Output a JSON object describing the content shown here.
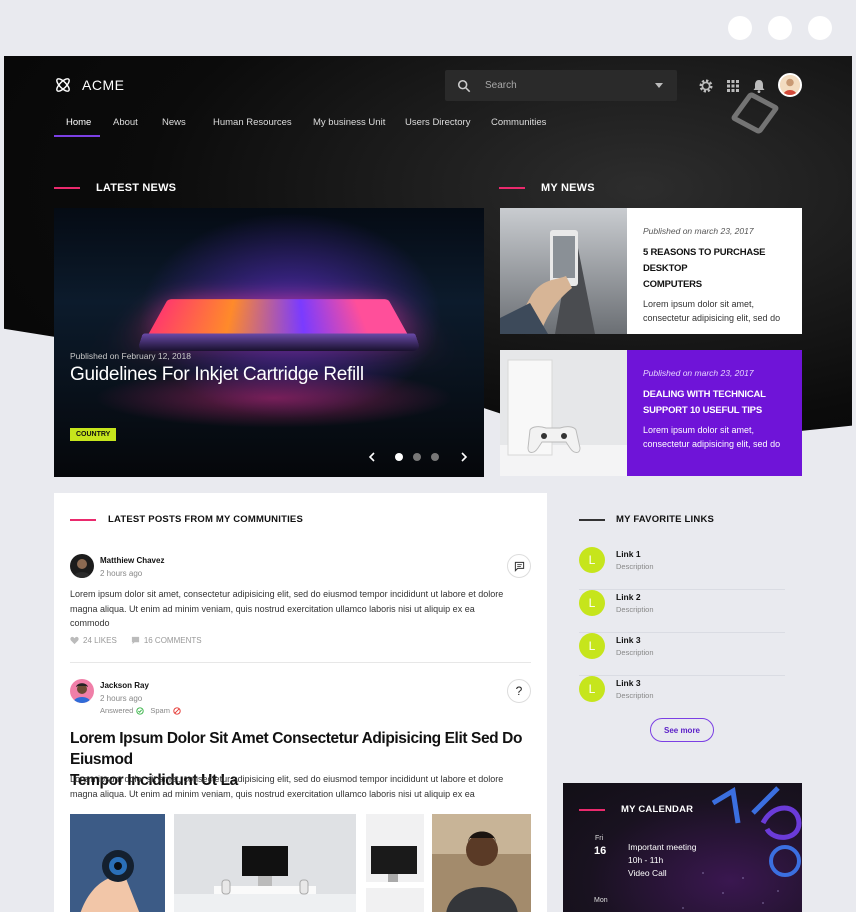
{
  "app": {
    "logo_text": "ACME",
    "search_placeholder": "Search"
  },
  "nav": {
    "items": [
      "Home",
      "About",
      "News",
      "Human Resources",
      "My business Unit",
      "Users Directory",
      "Communities"
    ],
    "active": "Home"
  },
  "latest_news": {
    "title": "LATEST NEWS",
    "slide": {
      "meta": "Published on February 12, 2018",
      "title": "Guidelines For Inkjet Cartridge Refill",
      "tag": "COUNTRY"
    },
    "slide_count": 3,
    "active_slide": 1
  },
  "my_news": {
    "title": "MY NEWS",
    "cards": [
      {
        "meta": "Published on march 23, 2017",
        "title_line1": "5 REASONS TO PURCHASE DESKTOP",
        "title_line2": "COMPUTERS",
        "text_line1": "Lorem ipsum dolor sit amet,",
        "text_line2": "consectetur adipisicing elit, sed do"
      },
      {
        "meta": "Published on march 23, 2017",
        "title_line1": "DEALING WITH TECHNICAL",
        "title_line2": "SUPPORT 10 USEFUL TIPS",
        "text_line1": "Lorem ipsum dolor sit amet,",
        "text_line2": "consectetur adipisicing elit, sed do"
      }
    ]
  },
  "posts": {
    "title": "LATEST POSTS FROM MY COMMUNITIES",
    "items": [
      {
        "author": "Matthiew Chavez",
        "time": "2 hours ago",
        "text_line1": "Lorem ipsum dolor sit amet, consectetur adipisicing elit, sed do eiusmod tempor incididunt ut labore et dolore",
        "text_line2": "magna aliqua. Ut enim ad minim veniam, quis nostrud exercitation ullamco laboris nisi ut aliquip ex ea",
        "text_line3": "commodo",
        "likes": "24 LIKES",
        "comments": "16 COMMENTS"
      },
      {
        "author": "Jackson Ray",
        "time": "2 hours ago",
        "answered": "Answered",
        "spam": "Spam",
        "headline_line1": "Lorem Ipsum Dolor Sit Amet Consectetur Adipisicing Elit Sed Do Eiusmod",
        "headline_line2": "Tempor Incididunt Ut La",
        "text_line1": "Lorem ipsum dolor sit amet, consectetur adipisicing elit, sed do eiusmod tempor incididunt ut labore et dolore",
        "text_line2": "magna aliqua. Ut enim ad minim veniam, quis nostrud exercitation ullamco laboris nisi ut aliquip ex ea",
        "question_mark": "?"
      }
    ]
  },
  "favorite_links": {
    "title": "MY FAVORITE LINKS",
    "items": [
      {
        "badge": "L",
        "name": "Link 1",
        "desc": "Description"
      },
      {
        "badge": "L",
        "name": "Link 2",
        "desc": "Description"
      },
      {
        "badge": "L",
        "name": "Link 3",
        "desc": "Description"
      },
      {
        "badge": "L",
        "name": "Link 3",
        "desc": "Description"
      }
    ],
    "see_more": "See more"
  },
  "calendar": {
    "title": "MY CALENDAR",
    "day": "Fri",
    "date": "16",
    "event_title": "Important meeting",
    "event_time": "10h - 11h",
    "event_type": "Video Call",
    "next_day": "Mon"
  },
  "colors": {
    "accent_pink": "#ea2a6d",
    "accent_purple": "#6f14d8",
    "accent_lime": "#c6e51c"
  }
}
